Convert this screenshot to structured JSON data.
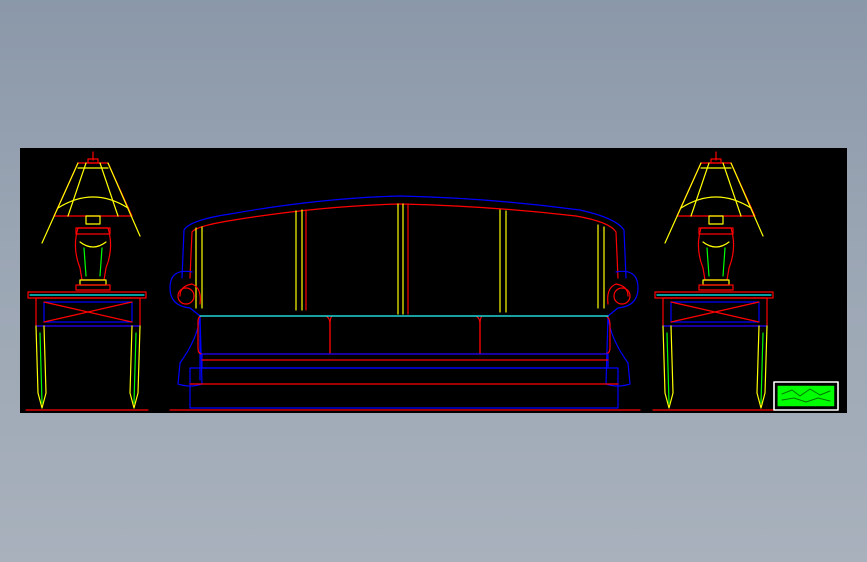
{
  "canvas": {
    "background_color": "#000000",
    "page_color": "#98a3b2"
  },
  "line_colors": {
    "red": "#ff0000",
    "yellow": "#ffff00",
    "blue": "#0000ff",
    "cyan": "#00ffff",
    "green": "#00ff00",
    "white": "#ffffff"
  },
  "objects": [
    {
      "name": "left-table-lamp",
      "kind": "lamp"
    },
    {
      "name": "left-side-table",
      "kind": "side-table"
    },
    {
      "name": "sofa",
      "kind": "sofa",
      "seat_cushions": 3
    },
    {
      "name": "right-table-lamp",
      "kind": "lamp"
    },
    {
      "name": "right-side-table",
      "kind": "side-table"
    },
    {
      "name": "title-stamp",
      "kind": "logo"
    }
  ]
}
